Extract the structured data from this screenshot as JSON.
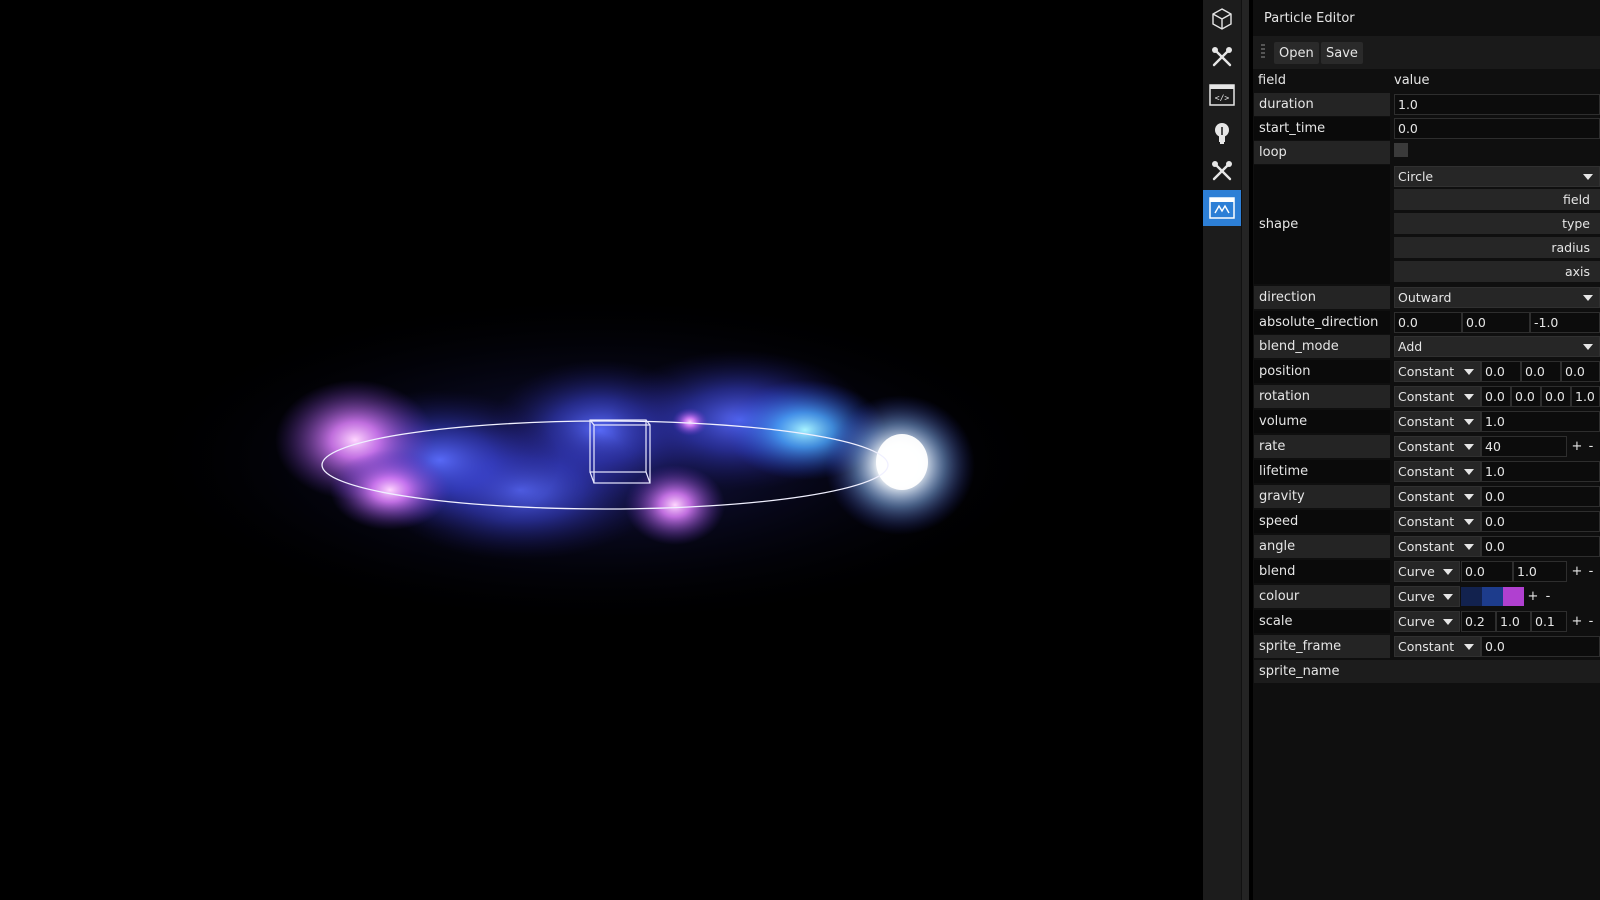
{
  "panel": {
    "title": "Particle Editor",
    "open_label": "Open",
    "save_label": "Save",
    "header_field": "field",
    "header_value": "value"
  },
  "toolbar": {
    "icons": [
      "cube-icon",
      "tools-icon",
      "code-icon",
      "lightbulb-icon",
      "tools-icon",
      "particle-editor-icon"
    ],
    "active_index": 5,
    "accent": "#2d7fd6"
  },
  "fields": {
    "duration": {
      "label": "duration",
      "value": "1.0"
    },
    "start_time": {
      "label": "start_time",
      "value": "0.0"
    },
    "loop": {
      "label": "loop",
      "checked": false
    },
    "shape": {
      "label": "shape",
      "value": "Circle",
      "sub": [
        "field",
        "type",
        "radius",
        "axis"
      ]
    },
    "direction": {
      "label": "direction",
      "value": "Outward"
    },
    "absolute_direction": {
      "label": "absolute_direction",
      "values": [
        "0.0",
        "0.0",
        "-1.0"
      ]
    },
    "blend_mode": {
      "label": "blend_mode",
      "value": "Add"
    },
    "position": {
      "label": "position",
      "mode": "Constant",
      "values": [
        "0.0",
        "0.0",
        "0.0"
      ]
    },
    "rotation": {
      "label": "rotation",
      "mode": "Constant",
      "values": [
        "0.0",
        "0.0",
        "0.0",
        "1.0"
      ]
    },
    "volume": {
      "label": "volume",
      "mode": "Constant",
      "value": "1.0"
    },
    "rate": {
      "label": "rate",
      "mode": "Constant",
      "value": "40"
    },
    "lifetime": {
      "label": "lifetime",
      "mode": "Constant",
      "value": "1.0"
    },
    "gravity": {
      "label": "gravity",
      "mode": "Constant",
      "value": "0.0"
    },
    "speed": {
      "label": "speed",
      "mode": "Constant",
      "value": "0.0"
    },
    "angle": {
      "label": "angle",
      "mode": "Constant",
      "value": "0.0"
    },
    "blend": {
      "label": "blend",
      "mode": "Curve",
      "values": [
        "0.0",
        "1.0"
      ]
    },
    "colour": {
      "label": "colour",
      "mode": "Curve",
      "swatches": [
        "#12224e",
        "#1d3c8c",
        "#b040d0"
      ]
    },
    "scale": {
      "label": "scale",
      "mode": "Curve",
      "values": [
        "0.2",
        "1.0",
        "0.1"
      ]
    },
    "sprite_frame": {
      "label": "sprite_frame",
      "mode": "Constant",
      "value": "0.0"
    },
    "sprite_name": {
      "label": "sprite_name",
      "value": ""
    }
  },
  "plus": "+",
  "minus": "-"
}
